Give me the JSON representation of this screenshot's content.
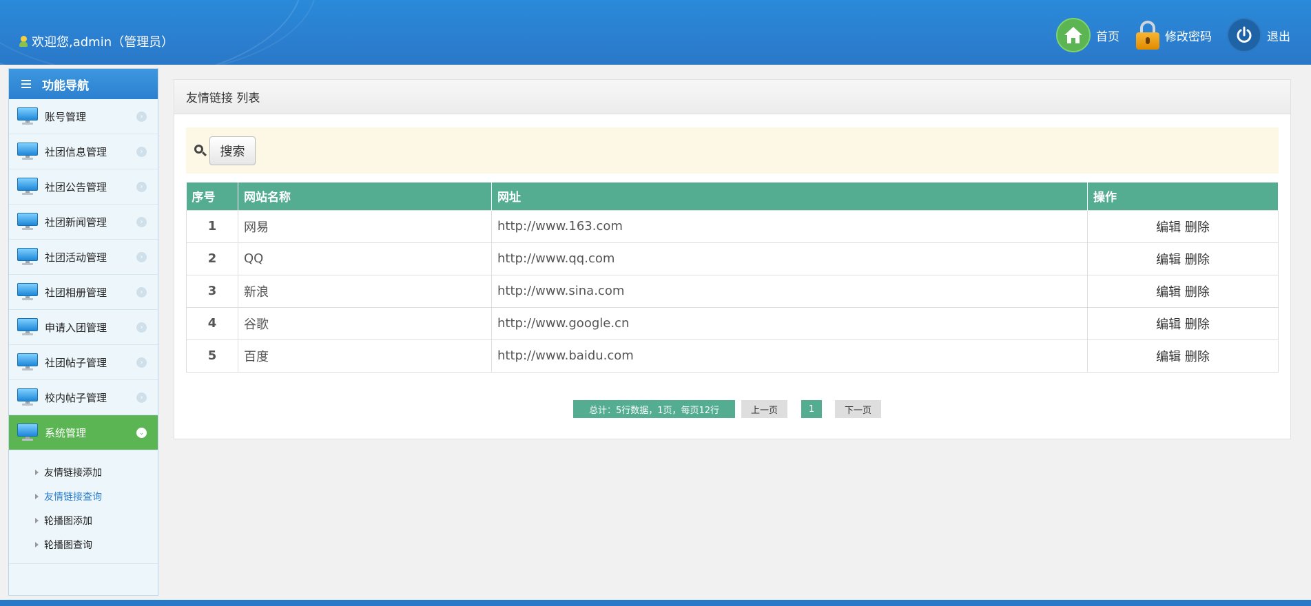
{
  "header": {
    "welcome": "欢迎您,admin（管理员）",
    "actions": [
      {
        "label": "首页",
        "icon": "home-icon"
      },
      {
        "label": "修改密码",
        "icon": "lock-icon"
      },
      {
        "label": "退出",
        "icon": "power-icon"
      }
    ]
  },
  "sidebar": {
    "title": "功能导航",
    "items": [
      {
        "label": "账号管理"
      },
      {
        "label": "社团信息管理"
      },
      {
        "label": "社团公告管理"
      },
      {
        "label": "社团新闻管理"
      },
      {
        "label": "社团活动管理"
      },
      {
        "label": "社团相册管理"
      },
      {
        "label": "申请入团管理"
      },
      {
        "label": "社团帖子管理"
      },
      {
        "label": "校内帖子管理"
      },
      {
        "label": "系统管理"
      }
    ],
    "subitems": [
      {
        "label": "友情链接添加"
      },
      {
        "label": "友情链接查询"
      },
      {
        "label": "轮播图添加"
      },
      {
        "label": "轮播图查询"
      }
    ]
  },
  "main": {
    "title": "友情链接 列表",
    "search_label": "搜索",
    "columns": [
      "序号",
      "网站名称",
      "网址",
      "操作"
    ],
    "rows": [
      {
        "no": "1",
        "name": "网易",
        "url": "http://www.163.com"
      },
      {
        "no": "2",
        "name": "QQ",
        "url": "http://www.qq.com"
      },
      {
        "no": "3",
        "name": "新浪",
        "url": "http://www.sina.com"
      },
      {
        "no": "4",
        "name": "谷歌",
        "url": "http://www.google.cn"
      },
      {
        "no": "5",
        "name": "百度",
        "url": "http://www.baidu.com"
      }
    ],
    "ops": {
      "edit": "编辑",
      "delete": "删除"
    },
    "pager": {
      "summary": "总计：5行数据，1页，每页12行",
      "prev": "上一页",
      "current": "1",
      "next": "下一页"
    }
  },
  "colors": {
    "header_blue": "#2b7fd0",
    "table_header_green": "#54ad91",
    "active_nav_green": "#5ab552"
  }
}
